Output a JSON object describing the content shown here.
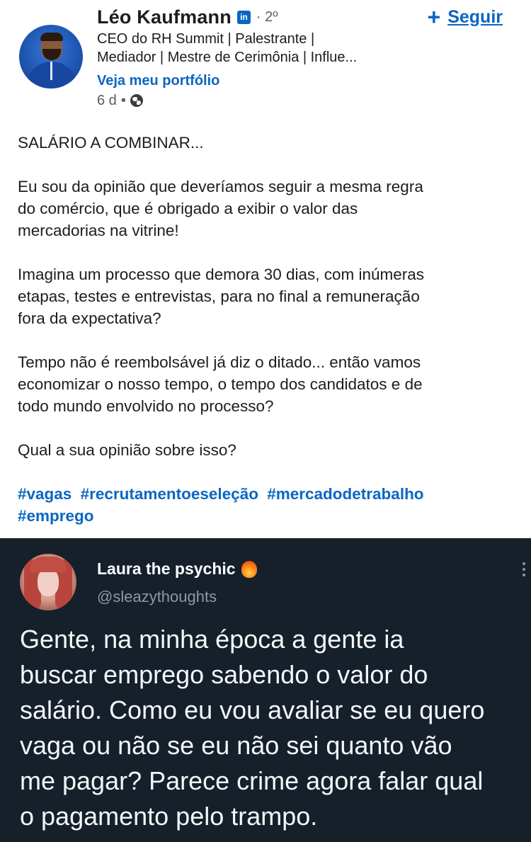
{
  "linkedin_post": {
    "author_name": "Léo Kaufmann",
    "platform_badge": "in",
    "connection_degree": "· 2º",
    "follow_label": "Seguir",
    "headline_line1": "CEO do RH Summit | Palestrante |",
    "headline_line2": "Mediador | Mestre de Cerimônia | Influe...",
    "portfolio_link": "Veja meu portfólio",
    "timestamp": "6 d",
    "dot": "•",
    "body": {
      "p1": "SALÁRIO A COMBINAR...",
      "p2_l1": "Eu sou da opinião que deveríamos seguir a mesma regra",
      "p2_l2": "do comércio, que é obrigado a exibir o valor das",
      "p2_l3": "mercadorias na vitrine!",
      "p3_l1": "Imagina um processo que demora 30 dias, com inúmeras",
      "p3_l2": "etapas, testes e entrevistas, para no final a remuneração",
      "p3_l3": "fora da expectativa?",
      "p4_l1": "Tempo não é reembolsável já diz o ditado... então vamos",
      "p4_l2": "economizar o nosso tempo, o tempo dos candidatos e de",
      "p4_l3": "todo mundo envolvido no processo?",
      "p5": "Qual a sua opinião sobre isso?"
    },
    "hashtags": [
      "#vagas",
      "#recrutamentoeseleção",
      "#mercadodetrabalho",
      "#emprego"
    ]
  },
  "tweet": {
    "display_name": "Laura the psychic",
    "handle": "@sleazythoughts",
    "text_l1": "Gente, na minha época a gente ia",
    "text_l2": "buscar emprego sabendo o valor do",
    "text_l3": "salário. Como eu vou avaliar se eu quero",
    "text_l4": "vaga ou não se eu não sei quanto vão",
    "text_l5": "me pagar? Parece crime agora falar qual",
    "text_l6": "o pagamento pelo trampo."
  },
  "colors": {
    "linkedin_blue": "#0a66c2",
    "tweet_bg": "#15202b",
    "tweet_text": "#f4f6f8",
    "tweet_muted": "#8b98a5"
  },
  "icons": {
    "linkedin_badge": "linkedin-logo-icon",
    "follow": "plus-icon",
    "visibility": "globe-icon",
    "tweet_emoji": "flame-heart-icon",
    "tweet_menu": "more-vertical-icon"
  }
}
